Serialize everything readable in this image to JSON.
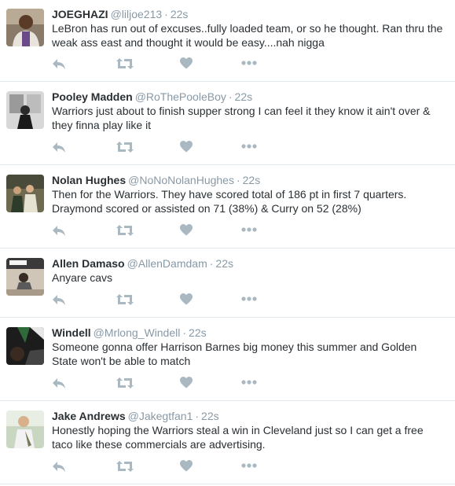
{
  "colors": {
    "name": "#292f33",
    "meta": "#8899a6",
    "action_icon": "#aab8c2",
    "divider": "#e1e8ed"
  },
  "icons": {
    "reply": "reply-icon",
    "retweet": "retweet-icon",
    "like": "heart-icon",
    "more": "more-icon"
  },
  "tweets": [
    {
      "fullname": "JOEGHAZI",
      "username": "@liljoe213",
      "separator": "·",
      "time": "22s",
      "text": "LeBron has run out of excuses..fully loaded team, or so he thought. Ran thru the weak ass east and thought it would be easy....nah nigga"
    },
    {
      "fullname": "Pooley Madden",
      "username": "@RoThePooleBoy",
      "separator": "·",
      "time": "22s",
      "text": "Warriors just about to finish supper strong I can feel it they know it ain't over & they finna play like it"
    },
    {
      "fullname": "Nolan Hughes",
      "username": "@NoNoNolanHughes",
      "separator": "·",
      "time": "22s",
      "text": "Then for the Warriors. They have scored total of 186 pt in first 7 quarters. Draymond scored or assisted on 71 (38%) & Curry on 52 (28%)"
    },
    {
      "fullname": "Allen Damaso",
      "username": "@AllenDamdam",
      "separator": "·",
      "time": "22s",
      "text": "Anyare cavs"
    },
    {
      "fullname": "Windell",
      "username": "@Mrlong_Windell",
      "separator": "·",
      "time": "22s",
      "text": "Someone gonna offer Harrison Barnes big money this summer and Golden State won't be able to match"
    },
    {
      "fullname": "Jake Andrews",
      "username": "@Jakegtfan1",
      "separator": "·",
      "time": "22s",
      "text": "Honestly hoping the Warriors steal a win in Cleveland just so I can get a free taco like these commercials are advertising."
    }
  ]
}
